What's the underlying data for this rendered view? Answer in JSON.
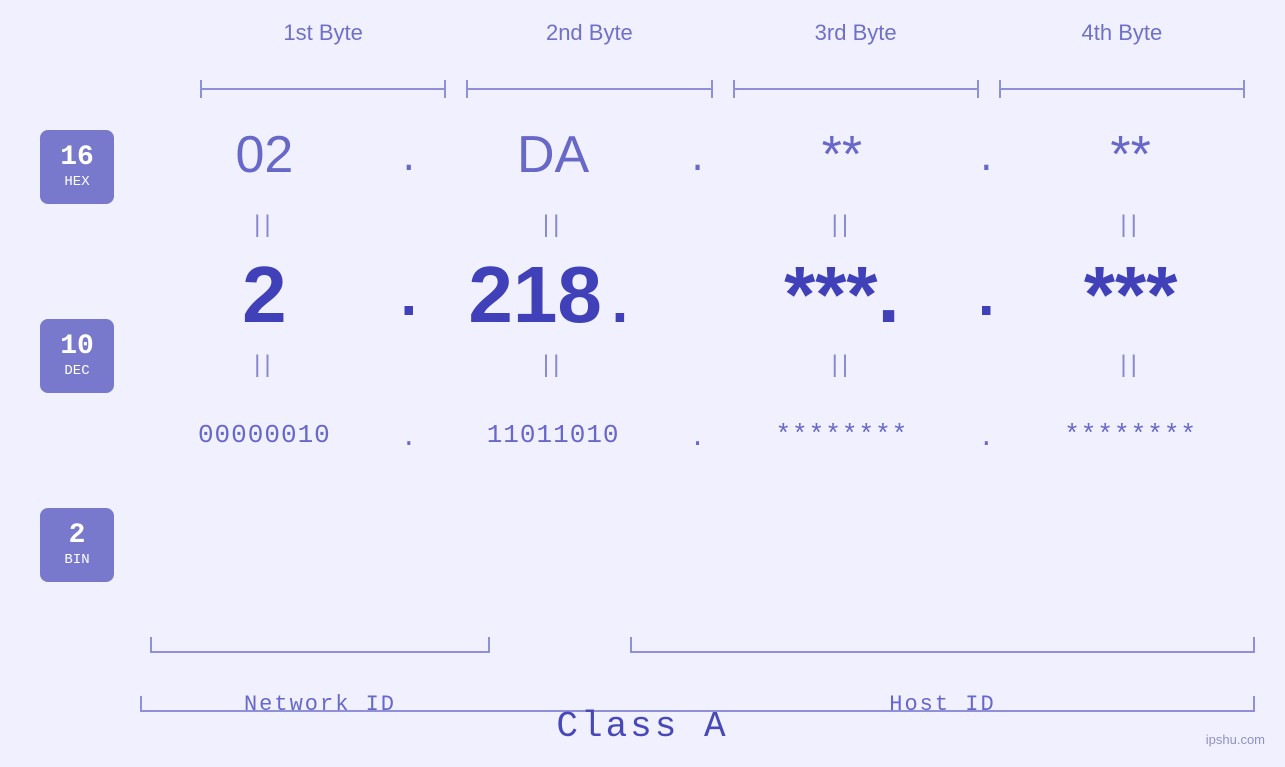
{
  "byteHeaders": [
    {
      "label": "1st Byte"
    },
    {
      "label": "2nd Byte"
    },
    {
      "label": "3rd Byte"
    },
    {
      "label": "4th Byte"
    }
  ],
  "bases": [
    {
      "number": "16",
      "name": "HEX"
    },
    {
      "number": "10",
      "name": "DEC"
    },
    {
      "number": "2",
      "name": "BIN"
    }
  ],
  "hexValues": [
    "02",
    "DA",
    "**",
    "**"
  ],
  "decValues": [
    "2",
    "218.",
    "***.",
    "***"
  ],
  "binValues": [
    "00000010",
    "11011010",
    "********",
    "********"
  ],
  "decDots": [
    ".",
    ""
  ],
  "labels": {
    "networkId": "Network ID",
    "hostId": "Host ID",
    "classA": "Class A"
  },
  "watermark": "ipshu.com",
  "equalSign": "||",
  "colors": {
    "accent": "#7878cc",
    "textMedium": "#6868c8",
    "textDark": "#4040b8",
    "bracket": "#9090d8"
  }
}
